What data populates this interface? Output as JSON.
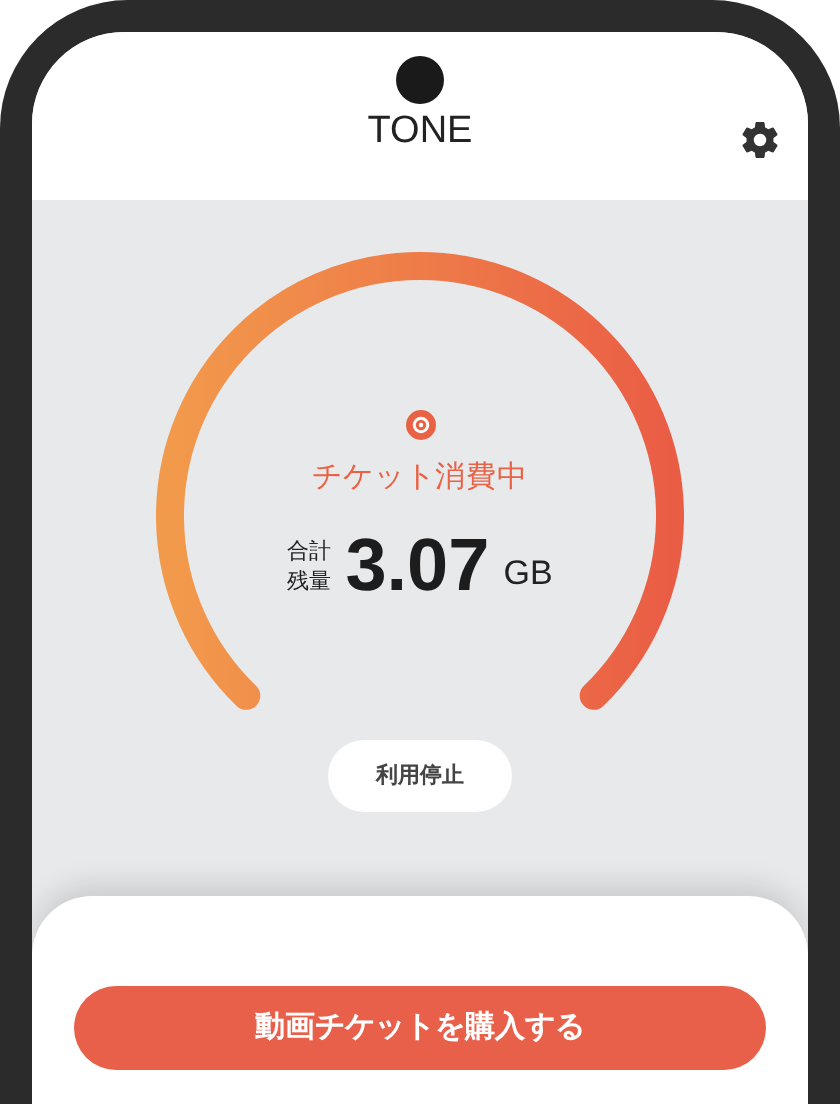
{
  "header": {
    "title": "TONE"
  },
  "gauge": {
    "status": "チケット消費中",
    "remaining_label_1": "合計",
    "remaining_label_2": "残量",
    "value": "3.07",
    "unit": "GB"
  },
  "stop_button": {
    "label": "利用停止"
  },
  "purchase_button": {
    "label": "動画チケットを購入する"
  }
}
